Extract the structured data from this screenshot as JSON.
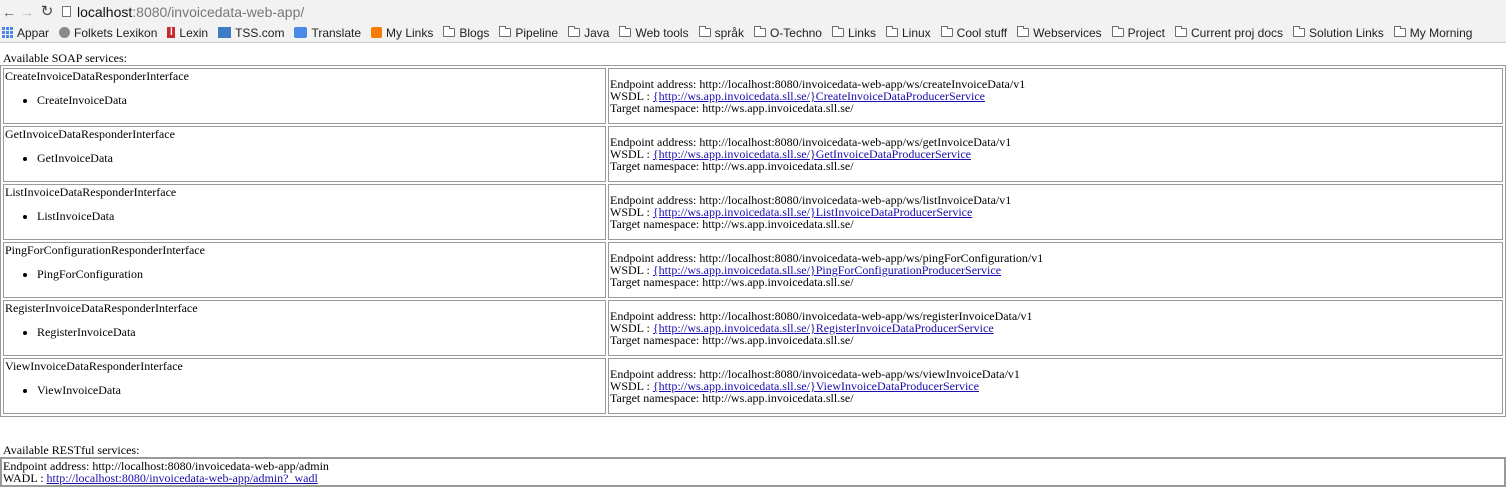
{
  "browser": {
    "url_host": "localhost",
    "url_path": ":8080/invoicedata-web-app/",
    "bookmarks": [
      {
        "label": "Appar",
        "icon": "apps-grid-icon"
      },
      {
        "label": "Folkets Lexikon",
        "icon": "lexikon-icon"
      },
      {
        "label": "Lexin",
        "icon": "lexin-icon"
      },
      {
        "label": "TSS.com",
        "icon": "tss-icon"
      },
      {
        "label": "Translate",
        "icon": "translate-icon"
      },
      {
        "label": "My Links",
        "icon": "blogger-icon"
      },
      {
        "label": "Blogs",
        "icon": "folder-icon"
      },
      {
        "label": "Pipeline",
        "icon": "folder-icon"
      },
      {
        "label": "Java",
        "icon": "folder-icon"
      },
      {
        "label": "Web tools",
        "icon": "folder-icon"
      },
      {
        "label": "språk",
        "icon": "folder-icon"
      },
      {
        "label": "O-Techno",
        "icon": "folder-icon"
      },
      {
        "label": "Links",
        "icon": "folder-icon"
      },
      {
        "label": "Linux",
        "icon": "folder-icon"
      },
      {
        "label": "Cool stuff",
        "icon": "folder-icon"
      },
      {
        "label": "Webservices",
        "icon": "folder-icon"
      },
      {
        "label": "Project",
        "icon": "folder-icon"
      },
      {
        "label": "Current proj docs",
        "icon": "folder-icon"
      },
      {
        "label": "Solution Links",
        "icon": "folder-icon"
      },
      {
        "label": "My Morning",
        "icon": "folder-icon"
      }
    ]
  },
  "soap": {
    "title": "Available SOAP services:",
    "services": [
      {
        "interface": "CreateInvoiceDataResponderInterface",
        "operation": "CreateInvoiceData",
        "endpoint": "Endpoint address: http://localhost:8080/invoicedata-web-app/ws/createInvoiceData/v1",
        "wsdl_label": "WSDL :",
        "wsdl_link": "{http://ws.app.invoicedata.sll.se/}CreateInvoiceDataProducerService",
        "namespace": "Target namespace: http://ws.app.invoicedata.sll.se/"
      },
      {
        "interface": "GetInvoiceDataResponderInterface",
        "operation": "GetInvoiceData",
        "endpoint": "Endpoint address: http://localhost:8080/invoicedata-web-app/ws/getInvoiceData/v1",
        "wsdl_label": "WSDL :",
        "wsdl_link": "{http://ws.app.invoicedata.sll.se/}GetInvoiceDataProducerService",
        "namespace": "Target namespace: http://ws.app.invoicedata.sll.se/"
      },
      {
        "interface": "ListInvoiceDataResponderInterface",
        "operation": "ListInvoiceData",
        "endpoint": "Endpoint address: http://localhost:8080/invoicedata-web-app/ws/listInvoiceData/v1",
        "wsdl_label": "WSDL :",
        "wsdl_link": "{http://ws.app.invoicedata.sll.se/}ListInvoiceDataProducerService",
        "namespace": "Target namespace: http://ws.app.invoicedata.sll.se/"
      },
      {
        "interface": "PingForConfigurationResponderInterface",
        "operation": "PingForConfiguration",
        "endpoint": "Endpoint address: http://localhost:8080/invoicedata-web-app/ws/pingForConfiguration/v1",
        "wsdl_label": "WSDL :",
        "wsdl_link": "{http://ws.app.invoicedata.sll.se/}PingForConfigurationProducerService",
        "namespace": "Target namespace: http://ws.app.invoicedata.sll.se/"
      },
      {
        "interface": "RegisterInvoiceDataResponderInterface",
        "operation": "RegisterInvoiceData",
        "endpoint": "Endpoint address: http://localhost:8080/invoicedata-web-app/ws/registerInvoiceData/v1",
        "wsdl_label": "WSDL :",
        "wsdl_link": "{http://ws.app.invoicedata.sll.se/}RegisterInvoiceDataProducerService",
        "namespace": "Target namespace: http://ws.app.invoicedata.sll.se/"
      },
      {
        "interface": "ViewInvoiceDataResponderInterface",
        "operation": "ViewInvoiceData",
        "endpoint": "Endpoint address: http://localhost:8080/invoicedata-web-app/ws/viewInvoiceData/v1",
        "wsdl_label": "WSDL :",
        "wsdl_link": "{http://ws.app.invoicedata.sll.se/}ViewInvoiceDataProducerService",
        "namespace": "Target namespace: http://ws.app.invoicedata.sll.se/"
      }
    ]
  },
  "rest": {
    "title": "Available RESTful services:",
    "endpoint": "Endpoint address: http://localhost:8080/invoicedata-web-app/admin",
    "wadl_label": "WADL :",
    "wadl_link": "http://localhost:8080/invoicedata-web-app/admin?_wadl"
  },
  "colors": {
    "link": "#1a0dab",
    "chrome_bg": "#f2f2f2",
    "border": "#9a9a9a"
  }
}
